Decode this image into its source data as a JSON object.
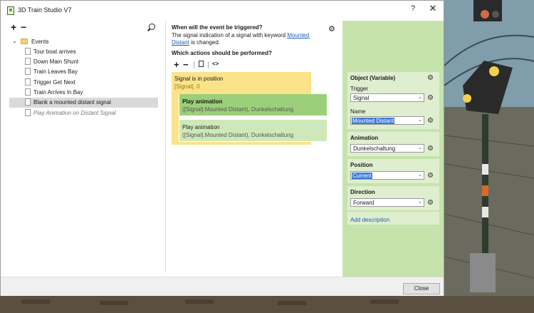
{
  "window": {
    "title": "3D Train Studio V7",
    "help": "?",
    "close": "✕"
  },
  "tree": {
    "root_label": "Events",
    "items": [
      {
        "label": "Tour boat arrives"
      },
      {
        "label": "Down Main Shunt"
      },
      {
        "label": "Train Leaves Bay"
      },
      {
        "label": "Trigger Get Next"
      },
      {
        "label": "Train Arrives In Bay"
      },
      {
        "label": "Blank a mounted distant signal",
        "selected": true
      },
      {
        "label": "Play Animation on Distant Signal",
        "italic": true
      }
    ]
  },
  "trigger": {
    "question": "When will the event be triggered?",
    "desc_pre": "The signal indication of a signal with keyword ",
    "desc_link": "Mounted Distant",
    "desc_post": " is changed."
  },
  "actions": {
    "question": "Which actions should be performed?",
    "condition": {
      "title": "Signal is in position",
      "args": "[Signal], 0"
    },
    "items": [
      {
        "title": "Play animation",
        "args": "([Signal].Mounted Distant), Dunkelschaltung"
      },
      {
        "title": "Play animation",
        "args": "([Signal].Mounted Distant), Dunkelschaltung"
      }
    ]
  },
  "props": {
    "object": {
      "header": "Object (Variable)",
      "trigger_label": "Trigger",
      "trigger_value": "Signal",
      "name_label": "Name",
      "name_value": "Mounted Distant"
    },
    "animation": {
      "header": "Animation",
      "value": "Dunkelschaltung"
    },
    "position": {
      "header": "Position",
      "value": "Current"
    },
    "direction": {
      "header": "Direction",
      "value": "Forward"
    },
    "add_description": "Add description"
  },
  "footer": {
    "close_label": "Close"
  },
  "colors": {
    "accent_green": "#c5e3ab",
    "condition_yellow": "#fbe38a",
    "action_green": "#9ccf7a"
  }
}
